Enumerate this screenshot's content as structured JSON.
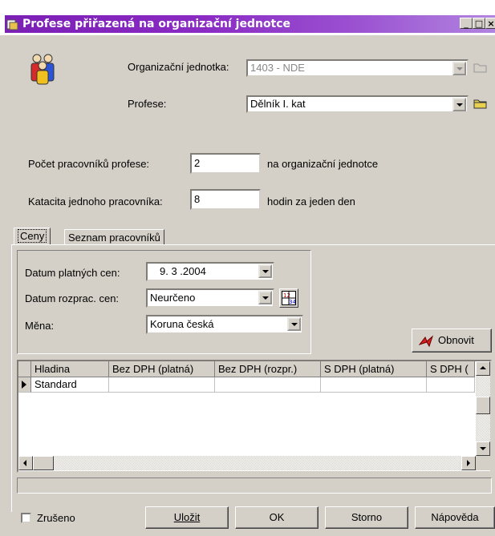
{
  "window": {
    "title": "Profese přiřazená na organizační jednotce",
    "minimize": "_",
    "maximize": "□",
    "close": "×"
  },
  "icons": {
    "title": "app-icon",
    "people": "people-group-icon",
    "folder_disabled": "folder-icon",
    "folder": "folder-icon",
    "calendar": "calculator-icon",
    "refresh": "refresh-icon"
  },
  "form": {
    "org_unit_label": "Organizační jednotka:",
    "org_unit_value": "1403 - NDE",
    "profession_label": "Profese:",
    "profession_value": "Dělník I. kat",
    "workers_count_label": "Počet pracovníků profese:",
    "workers_count_value": "2",
    "workers_count_suffix": "na organizační jednotce",
    "capacity_label": "Katacita jednoho pracovníka:",
    "capacity_value": "8",
    "capacity_suffix": "hodin za jeden den"
  },
  "tabs": [
    {
      "label": "Ceny"
    },
    {
      "label": "Seznam pracovníků"
    }
  ],
  "prices": {
    "valid_date_label": "Datum platných cen:",
    "valid_date_value": "9. 3 .2004",
    "proc_date_label": "Datum rozprac. cen:",
    "proc_date_value": "Neurčeno",
    "currency_label": "Měna:",
    "currency_value": "Koruna česká",
    "refresh_label": "Obnovit"
  },
  "grid": {
    "columns": [
      "Hladina",
      "Bez DPH (platná)",
      "Bez DPH (rozpr.)",
      "S DPH (platná)",
      "S DPH ("
    ],
    "rows": [
      [
        "Standard",
        "",
        "",
        "",
        ""
      ]
    ]
  },
  "footer": {
    "cancelled_label": "Zrušeno",
    "save_label": "Uložit",
    "ok_label": "OK",
    "storno_label": "Storno",
    "help_label": "Nápověda"
  }
}
